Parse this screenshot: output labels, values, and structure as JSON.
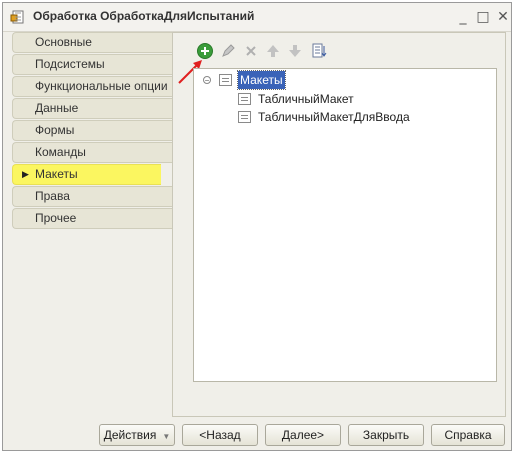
{
  "window": {
    "title": "Обработка ОбработкаДляИспытаний",
    "controls": {
      "minimize": "_",
      "maximize": "□",
      "close": "✕"
    }
  },
  "tabs": [
    {
      "label": "Основные",
      "active": false
    },
    {
      "label": "Подсистемы",
      "active": false
    },
    {
      "label": "Функциональные опции",
      "active": false
    },
    {
      "label": "Данные",
      "active": false
    },
    {
      "label": "Формы",
      "active": false
    },
    {
      "label": "Команды",
      "active": false
    },
    {
      "label": "Макеты",
      "active": true
    },
    {
      "label": "Права",
      "active": false
    },
    {
      "label": "Прочее",
      "active": false
    }
  ],
  "toolbar": {
    "icons": [
      "add-icon",
      "edit-icon",
      "delete-icon",
      "move-up-icon",
      "move-down-icon",
      "sort-icon"
    ]
  },
  "tree": {
    "root": {
      "label": "Макеты",
      "expand_symbol": "−",
      "selected": true
    },
    "children": [
      {
        "label": "ТабличныйМакет"
      },
      {
        "label": "ТабличныйМакетДляВвода"
      }
    ]
  },
  "footer": {
    "actions_label": "Действия",
    "back_label": "<Назад",
    "next_label": "Далее>",
    "close_label": "Закрыть",
    "help_label": "Справка"
  },
  "colors": {
    "active_tab": "#fbf660",
    "selection": "#3a63b8",
    "annotation_arrow": "#e02020",
    "add_button": "#3a9c3a"
  }
}
